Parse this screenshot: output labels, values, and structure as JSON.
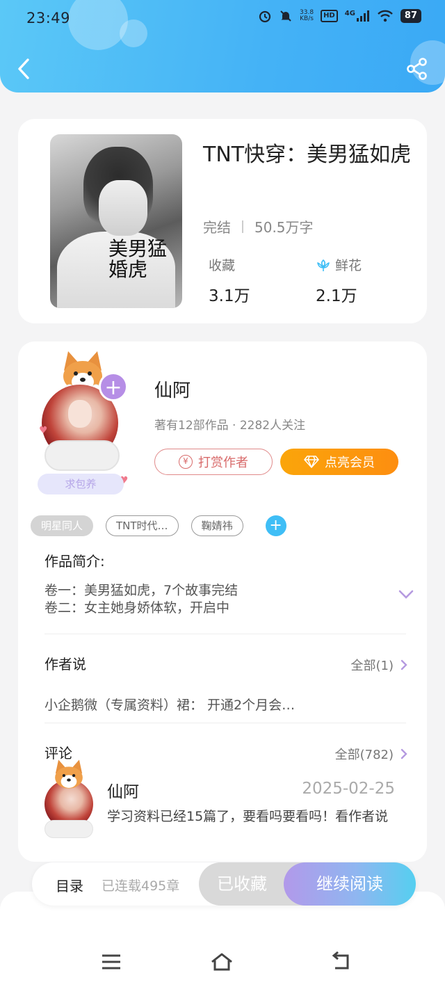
{
  "status_bar": {
    "time": "23:49",
    "net_speed_value": "33.8",
    "net_speed_unit": "KB/s",
    "hd_label": "HD",
    "network_label": "4G",
    "battery": "87"
  },
  "colors": {
    "header_gradient_start": "#5bc8f7",
    "header_gradient_end": "#3aa9f5",
    "accent_blue": "#3fbef6",
    "vip_orange": "#fd8e10",
    "tip_red": "#d86a6a",
    "plus_purple": "#b68ee6"
  },
  "header": {
    "back_icon": "chevron-left-icon",
    "share_icon": "share-icon"
  },
  "book": {
    "cover_title": "美男猛婚虎",
    "title": "TNT快穿：美男猛如虎",
    "status": "完结",
    "word_count": "50.5万字",
    "favorites_label": "收藏",
    "favorites_value": "3.1万",
    "flowers_label": "鲜花",
    "flowers_value": "2.1万"
  },
  "author": {
    "name": "仙阿",
    "stats": "著有12部作品 · 2282人关注",
    "beg_badge": "求包养",
    "tip_button": "打赏作者",
    "tip_icon_glyph": "¥",
    "vip_button": "点亮会员"
  },
  "tags": [
    "明星同人",
    "TNT时代…",
    "鞠婧祎"
  ],
  "intro": {
    "title": "作品简介:",
    "lines": [
      "卷一：美男猛如虎，7个故事完结",
      "卷二：女主她身娇体软，开启中"
    ]
  },
  "author_says": {
    "title": "作者说",
    "see_all": "全部(1)",
    "text": "小企鹅微（专属资料）裙： 开通2个月会…"
  },
  "comments": {
    "title": "评论",
    "see_all": "全部(782)",
    "items": [
      {
        "user": "仙阿",
        "date": "2025-02-25",
        "text": "学习资料已经15篇了，要看吗要看吗！看作者说"
      }
    ]
  },
  "action_bar": {
    "toc": "目录",
    "serial": "已连载495章",
    "collected": "已收藏",
    "continue": "继续阅读"
  }
}
